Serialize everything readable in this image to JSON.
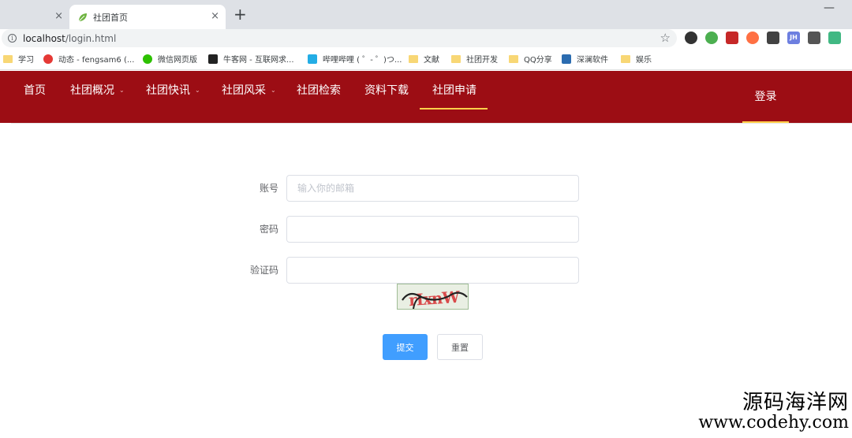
{
  "browser": {
    "tabs": [
      {
        "title": "",
        "active": false
      },
      {
        "title": "社团首页",
        "active": true
      }
    ],
    "new_tab_symbol": "+",
    "close_symbol": "×",
    "minimize_symbol": "—",
    "address": {
      "host": "localhost",
      "path": "/login.html"
    },
    "bookmarks": [
      {
        "label": "学习",
        "icon": "folder-icon"
      },
      {
        "label": "动态 - fengsam6 (...",
        "icon": "site-g-icon",
        "color": "#e53935"
      },
      {
        "label": "微信网页版",
        "icon": "wechat-icon",
        "color": "#2dc100"
      },
      {
        "label": "牛客网 - 互联网求...",
        "icon": "nowcoder-icon",
        "color": "#222222"
      },
      {
        "label": "哔哩哔哩 ( ゜- ゜)つ...",
        "icon": "bilibili-icon",
        "color": "#23ade5"
      },
      {
        "label": "文献",
        "icon": "folder-icon"
      },
      {
        "label": "社团开发",
        "icon": "folder-icon"
      },
      {
        "label": "QQ分享",
        "icon": "folder-icon"
      },
      {
        "label": "深澜软件",
        "icon": "srun-icon",
        "color": "#2b6cb0"
      },
      {
        "label": "娱乐",
        "icon": "folder-icon"
      }
    ],
    "extensions": [
      {
        "name": "camera-ext-icon",
        "color": "#333333"
      },
      {
        "name": "chrome-ext-icon",
        "color": "#4caf50"
      },
      {
        "name": "ublock-ext-icon",
        "color": "#c62828"
      },
      {
        "name": "glasses-ext-icon",
        "color": "#ff7043"
      },
      {
        "name": "ghost-ext-icon",
        "color": "#424242"
      },
      {
        "name": "jh-ext-icon",
        "color": "#6d7fe0",
        "text": "JH"
      },
      {
        "name": "chart-ext-icon",
        "color": "#555555"
      },
      {
        "name": "vue-ext-icon",
        "color": "#41b883"
      }
    ]
  },
  "nav": {
    "items": [
      {
        "label": "首页",
        "dropdown": false
      },
      {
        "label": "社团概况",
        "dropdown": true
      },
      {
        "label": "社团快讯",
        "dropdown": true
      },
      {
        "label": "社团风采",
        "dropdown": true
      },
      {
        "label": "社团检索",
        "dropdown": false
      },
      {
        "label": "资料下载",
        "dropdown": false
      },
      {
        "label": "社团申请",
        "dropdown": false,
        "active": true
      }
    ],
    "login": "登录",
    "colors": {
      "background": "#9c0d14",
      "active_underline": "#ffd04b"
    }
  },
  "form": {
    "account": {
      "label": "账号",
      "placeholder": "输入你的邮箱",
      "value": ""
    },
    "password": {
      "label": "密码",
      "value": ""
    },
    "captcha": {
      "label": "验证码",
      "value": "",
      "image_text": "rIxnW"
    },
    "submit": "提交",
    "reset": "重置",
    "colors": {
      "primary": "#409eff"
    }
  },
  "watermark": {
    "line1": "源码海洋网",
    "line2": "www.codehy.com"
  }
}
